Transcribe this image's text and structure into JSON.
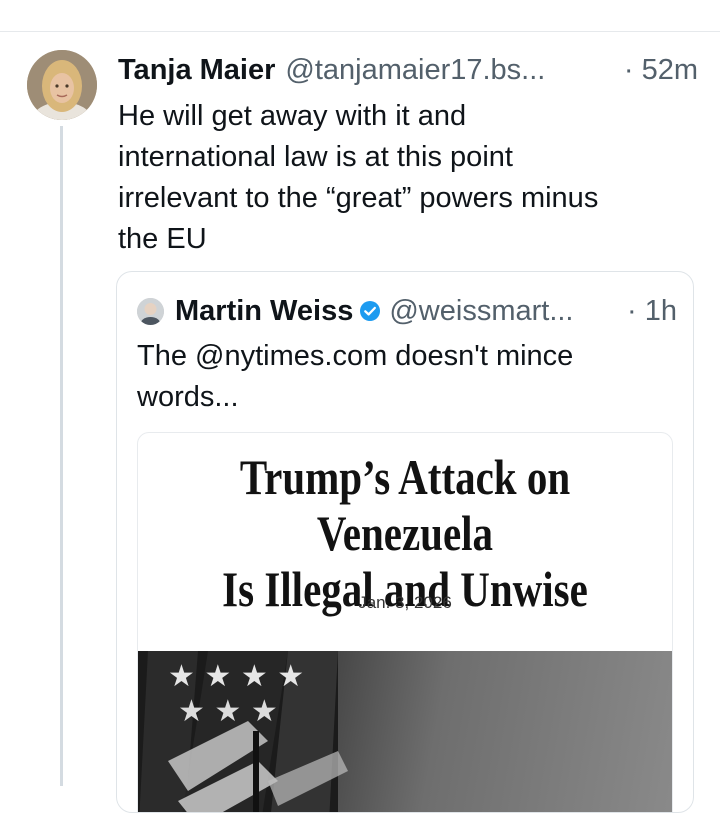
{
  "post": {
    "author_name": "Tanja Maier",
    "handle": "@tanjamaier17.bs...",
    "time": "· 52m",
    "text_lines": [
      "He will get away with it and",
      "international law is at this point",
      "irrelevant to the “great” powers minus",
      "the EU"
    ]
  },
  "quote": {
    "author_name": "Martin Weiss",
    "handle": "@weissmart...",
    "time": "· 1h",
    "text_lines": [
      "The @nytimes.com doesn't mince",
      "words..."
    ],
    "embed": {
      "headline_lines": [
        "Trump’s Attack on Venezuela",
        "Is Illegal and Unwise"
      ],
      "date": "Jan. 3, 2026"
    }
  },
  "icons": {
    "verified": "verified-badge-icon",
    "verified_color": "#1d9bf0"
  }
}
